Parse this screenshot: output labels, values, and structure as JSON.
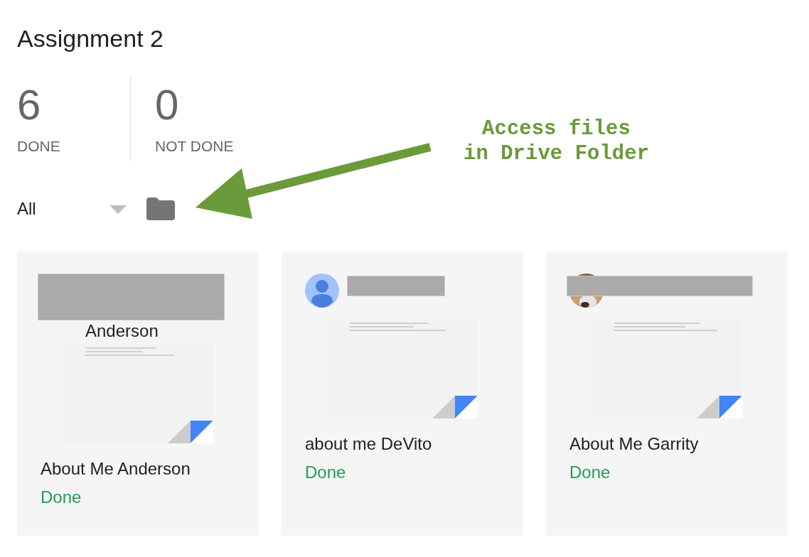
{
  "title": "Assignment 2",
  "stats": [
    {
      "count": "6",
      "label": "DONE"
    },
    {
      "count": "0",
      "label": "NOT DONE"
    }
  ],
  "filter": {
    "value": "All"
  },
  "annotation": {
    "lines": [
      "Access files",
      "in Drive Folder"
    ]
  },
  "cards": [
    {
      "kind": "none",
      "name": "Anderson",
      "file": "About Me Anderson",
      "status": "Done",
      "done": true
    },
    {
      "kind": "generic",
      "file": "about me DeVito",
      "status": "Done",
      "done": true
    },
    {
      "file": "About Me Garrity",
      "status": "Done",
      "done": true
    }
  ]
}
